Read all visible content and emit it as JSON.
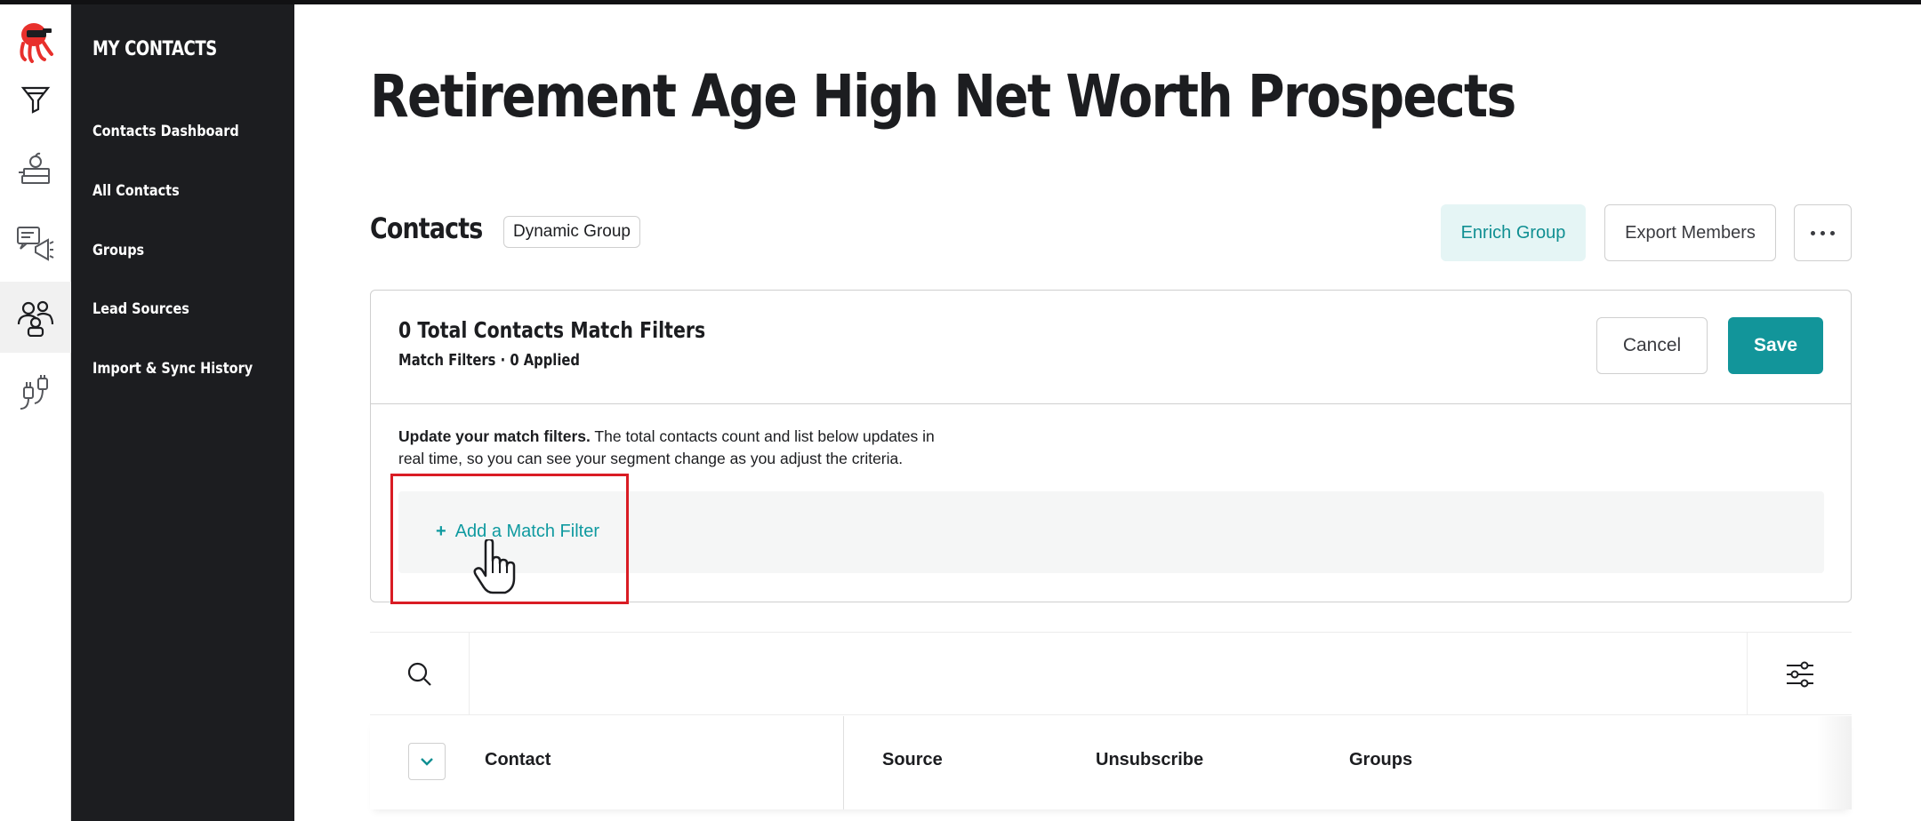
{
  "app": {
    "icons": [
      "octopus-logo-icon",
      "funnel-icon",
      "books-icon",
      "megaphone-icon",
      "contacts-icon",
      "integrations-icon"
    ],
    "colors": {
      "accent": "#12959a",
      "accent_light": "#e5f5f5",
      "nav_bg": "#1c1d20",
      "highlight": "#d91c24"
    }
  },
  "nav": {
    "title": "MY CONTACTS",
    "items": [
      {
        "label": "Contacts Dashboard"
      },
      {
        "label": "All Contacts"
      },
      {
        "label": "Groups"
      },
      {
        "label": "Lead Sources"
      },
      {
        "label": "Import & Sync History"
      }
    ]
  },
  "page": {
    "title": "Retirement Age High Net Worth Prospects"
  },
  "contacts": {
    "title": "Contacts",
    "badge": "Dynamic Group",
    "enrich_label": "Enrich Group",
    "export_label": "Export Members"
  },
  "filters": {
    "title": "0 Total Contacts Match Filters",
    "subtitle": "Match Filters · 0 Applied",
    "cancel_label": "Cancel",
    "save_label": "Save",
    "desc_bold": "Update your match filters.",
    "desc_rest": " The total contacts count and list below updates in real time, so you can see your segment change as you adjust the criteria.",
    "add_plus": "+",
    "add_label": "Add a Match Filter"
  },
  "search": {
    "placeholder": ""
  },
  "table": {
    "columns": [
      "Contact",
      "Source",
      "Unsubscribe",
      "Groups"
    ]
  }
}
